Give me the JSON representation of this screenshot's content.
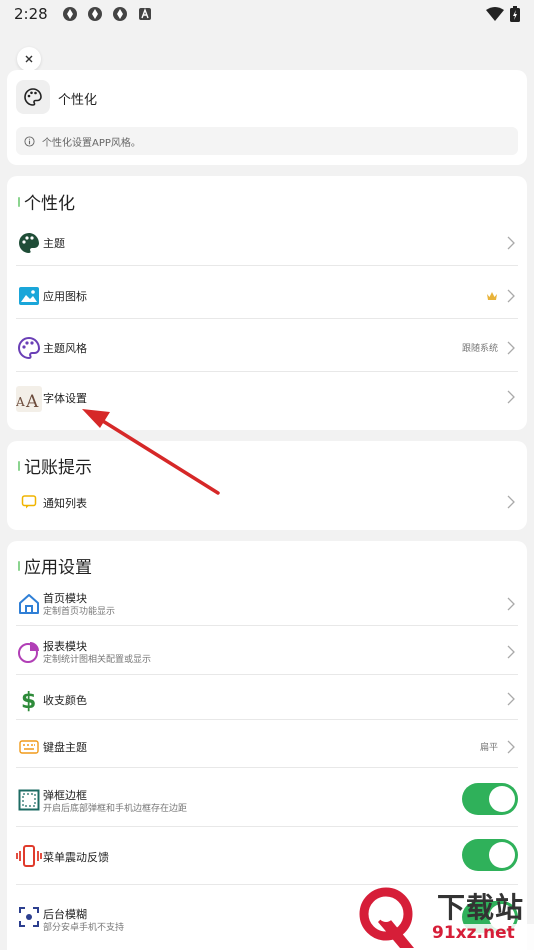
{
  "status_bar": {
    "time": "2:28"
  },
  "header": {
    "title": "个性化",
    "note": "个性化设置APP风格。"
  },
  "sections": {
    "personalize": {
      "title": "个性化",
      "items": [
        {
          "label": "主题",
          "icon": "palette-icon"
        },
        {
          "label": "应用图标",
          "icon": "image-icon"
        },
        {
          "label": "主题风格",
          "value": "跟随系统",
          "icon": "palette-outline-icon"
        },
        {
          "label": "字体设置",
          "icon": "font-icon"
        }
      ]
    },
    "reminder": {
      "title": "记账提示",
      "items": [
        {
          "label": "通知列表",
          "icon": "chat-bubble-icon"
        }
      ]
    },
    "app": {
      "title": "应用设置",
      "items": [
        {
          "label": "首页模块",
          "sub": "定制首页功能显示",
          "icon": "home-icon"
        },
        {
          "label": "报表模块",
          "sub": "定制统计图相关配置或显示",
          "icon": "pie-chart-icon"
        },
        {
          "label": "收支颜色",
          "icon": "dollar-icon"
        },
        {
          "label": "键盘主题",
          "value": "扁平",
          "icon": "keyboard-icon"
        },
        {
          "label": "弹框边框",
          "sub": "开启后底部弹框和手机边框存在边距",
          "toggle": true,
          "icon": "frame-icon"
        },
        {
          "label": "菜单震动反馈",
          "toggle": true,
          "icon": "vibrate-icon"
        },
        {
          "label": "后台模糊",
          "sub": "部分安卓手机不支持",
          "toggle": true,
          "icon": "blur-icon"
        }
      ]
    }
  },
  "watermark": {
    "text": "下载站",
    "domain": "91xz.net"
  },
  "colors": {
    "accent_green": "#2fb15a",
    "annotation_red": "#d62828"
  }
}
